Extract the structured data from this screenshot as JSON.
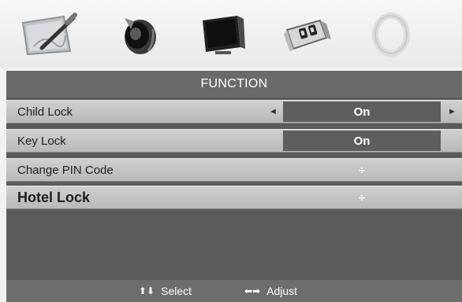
{
  "tabs": [
    {
      "name": "picture-icon"
    },
    {
      "name": "sound-icon"
    },
    {
      "name": "screen-icon"
    },
    {
      "name": "function-icon"
    },
    {
      "name": "setup-icon"
    }
  ],
  "menu": {
    "title": "FUNCTION",
    "items": [
      {
        "label": "Child Lock",
        "value": "On",
        "left_arrow": "◄",
        "right_arrow": "►"
      },
      {
        "label": "Key Lock",
        "value": "On"
      },
      {
        "label": "Change PIN Code",
        "submenu_glyph": "÷"
      },
      {
        "label": "Hotel Lock",
        "submenu_glyph": "÷"
      }
    ]
  },
  "footer": {
    "select_glyph": "⬆⬇",
    "select_label": "Select",
    "adjust_glyph": "⬅➡",
    "adjust_label": "Adjust"
  },
  "colors": {
    "panel": "#5b5b5b",
    "row": "#c4c4c4",
    "value_box": "#5e5e5e",
    "text_light": "#ffffff",
    "text_dark": "#1e1e1e"
  }
}
